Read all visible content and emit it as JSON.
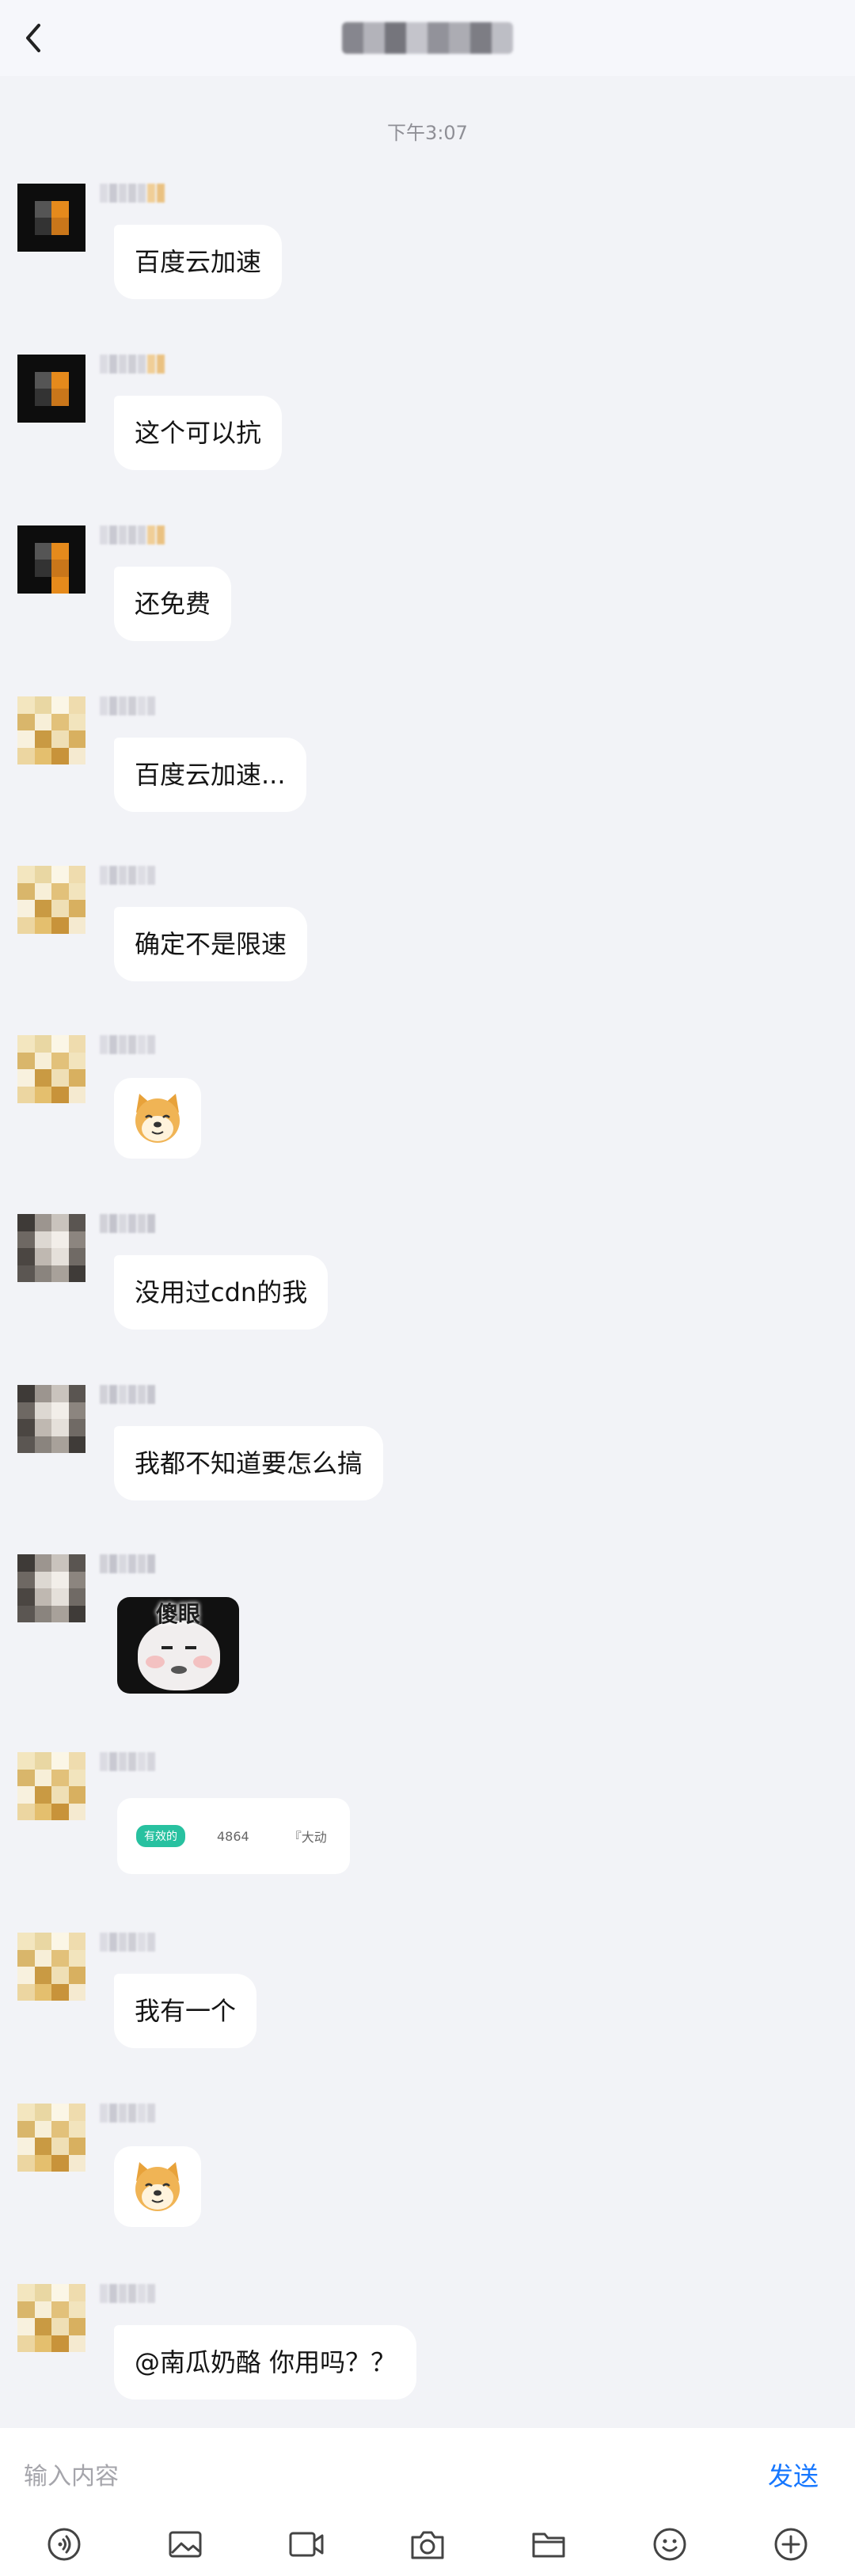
{
  "header": {
    "back_icon": "chevron-left-icon"
  },
  "timestamp": "下午3:07",
  "messages": [
    {
      "type": "text",
      "text": "百度云加速"
    },
    {
      "type": "text",
      "text": "这个可以抗"
    },
    {
      "type": "text",
      "text": "还免费"
    },
    {
      "type": "text",
      "text": "百度云加速..."
    },
    {
      "type": "text",
      "text": "确定不是限速"
    },
    {
      "type": "sticker",
      "sticker": "doge-sticker"
    },
    {
      "type": "text",
      "text": "没用过cdn的我"
    },
    {
      "type": "text",
      "text": "我都不知道要怎么搞"
    },
    {
      "type": "meme",
      "meme_text": "傻眼"
    },
    {
      "type": "card",
      "tag": "有效的",
      "number": "4864",
      "more": "『大动"
    },
    {
      "type": "text",
      "text": "我有一个"
    },
    {
      "type": "sticker",
      "sticker": "doge-sticker"
    },
    {
      "type": "text",
      "text": "@南瓜奶酪 你用吗？？"
    }
  ],
  "input": {
    "placeholder": "输入内容",
    "send_label": "发送"
  },
  "toolbar": {
    "icons": [
      "voice-icon",
      "image-icon",
      "video-icon",
      "camera-icon",
      "folder-icon",
      "emoji-icon",
      "plus-icon"
    ]
  },
  "colors": {
    "background": "#f2f3f7",
    "bubble": "#ffffff",
    "accent": "#1677ff",
    "tag": "#28c1a0"
  }
}
